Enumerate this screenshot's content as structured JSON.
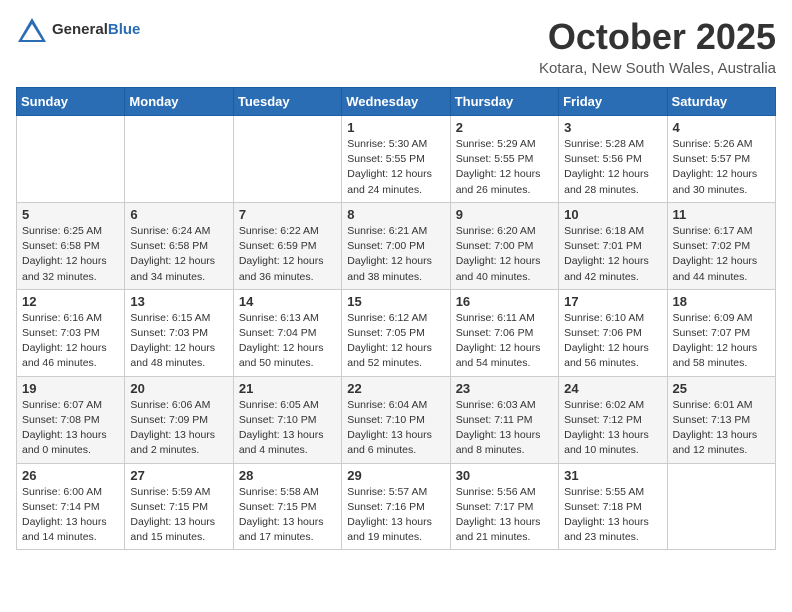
{
  "header": {
    "logo_general": "General",
    "logo_blue": "Blue",
    "month_title": "October 2025",
    "location": "Kotara, New South Wales, Australia"
  },
  "weekdays": [
    "Sunday",
    "Monday",
    "Tuesday",
    "Wednesday",
    "Thursday",
    "Friday",
    "Saturday"
  ],
  "weeks": [
    [
      {
        "day": "",
        "content": ""
      },
      {
        "day": "",
        "content": ""
      },
      {
        "day": "",
        "content": ""
      },
      {
        "day": "1",
        "content": "Sunrise: 5:30 AM\nSunset: 5:55 PM\nDaylight: 12 hours\nand 24 minutes."
      },
      {
        "day": "2",
        "content": "Sunrise: 5:29 AM\nSunset: 5:55 PM\nDaylight: 12 hours\nand 26 minutes."
      },
      {
        "day": "3",
        "content": "Sunrise: 5:28 AM\nSunset: 5:56 PM\nDaylight: 12 hours\nand 28 minutes."
      },
      {
        "day": "4",
        "content": "Sunrise: 5:26 AM\nSunset: 5:57 PM\nDaylight: 12 hours\nand 30 minutes."
      }
    ],
    [
      {
        "day": "5",
        "content": "Sunrise: 6:25 AM\nSunset: 6:58 PM\nDaylight: 12 hours\nand 32 minutes."
      },
      {
        "day": "6",
        "content": "Sunrise: 6:24 AM\nSunset: 6:58 PM\nDaylight: 12 hours\nand 34 minutes."
      },
      {
        "day": "7",
        "content": "Sunrise: 6:22 AM\nSunset: 6:59 PM\nDaylight: 12 hours\nand 36 minutes."
      },
      {
        "day": "8",
        "content": "Sunrise: 6:21 AM\nSunset: 7:00 PM\nDaylight: 12 hours\nand 38 minutes."
      },
      {
        "day": "9",
        "content": "Sunrise: 6:20 AM\nSunset: 7:00 PM\nDaylight: 12 hours\nand 40 minutes."
      },
      {
        "day": "10",
        "content": "Sunrise: 6:18 AM\nSunset: 7:01 PM\nDaylight: 12 hours\nand 42 minutes."
      },
      {
        "day": "11",
        "content": "Sunrise: 6:17 AM\nSunset: 7:02 PM\nDaylight: 12 hours\nand 44 minutes."
      }
    ],
    [
      {
        "day": "12",
        "content": "Sunrise: 6:16 AM\nSunset: 7:03 PM\nDaylight: 12 hours\nand 46 minutes."
      },
      {
        "day": "13",
        "content": "Sunrise: 6:15 AM\nSunset: 7:03 PM\nDaylight: 12 hours\nand 48 minutes."
      },
      {
        "day": "14",
        "content": "Sunrise: 6:13 AM\nSunset: 7:04 PM\nDaylight: 12 hours\nand 50 minutes."
      },
      {
        "day": "15",
        "content": "Sunrise: 6:12 AM\nSunset: 7:05 PM\nDaylight: 12 hours\nand 52 minutes."
      },
      {
        "day": "16",
        "content": "Sunrise: 6:11 AM\nSunset: 7:06 PM\nDaylight: 12 hours\nand 54 minutes."
      },
      {
        "day": "17",
        "content": "Sunrise: 6:10 AM\nSunset: 7:06 PM\nDaylight: 12 hours\nand 56 minutes."
      },
      {
        "day": "18",
        "content": "Sunrise: 6:09 AM\nSunset: 7:07 PM\nDaylight: 12 hours\nand 58 minutes."
      }
    ],
    [
      {
        "day": "19",
        "content": "Sunrise: 6:07 AM\nSunset: 7:08 PM\nDaylight: 13 hours\nand 0 minutes."
      },
      {
        "day": "20",
        "content": "Sunrise: 6:06 AM\nSunset: 7:09 PM\nDaylight: 13 hours\nand 2 minutes."
      },
      {
        "day": "21",
        "content": "Sunrise: 6:05 AM\nSunset: 7:10 PM\nDaylight: 13 hours\nand 4 minutes."
      },
      {
        "day": "22",
        "content": "Sunrise: 6:04 AM\nSunset: 7:10 PM\nDaylight: 13 hours\nand 6 minutes."
      },
      {
        "day": "23",
        "content": "Sunrise: 6:03 AM\nSunset: 7:11 PM\nDaylight: 13 hours\nand 8 minutes."
      },
      {
        "day": "24",
        "content": "Sunrise: 6:02 AM\nSunset: 7:12 PM\nDaylight: 13 hours\nand 10 minutes."
      },
      {
        "day": "25",
        "content": "Sunrise: 6:01 AM\nSunset: 7:13 PM\nDaylight: 13 hours\nand 12 minutes."
      }
    ],
    [
      {
        "day": "26",
        "content": "Sunrise: 6:00 AM\nSunset: 7:14 PM\nDaylight: 13 hours\nand 14 minutes."
      },
      {
        "day": "27",
        "content": "Sunrise: 5:59 AM\nSunset: 7:15 PM\nDaylight: 13 hours\nand 15 minutes."
      },
      {
        "day": "28",
        "content": "Sunrise: 5:58 AM\nSunset: 7:15 PM\nDaylight: 13 hours\nand 17 minutes."
      },
      {
        "day": "29",
        "content": "Sunrise: 5:57 AM\nSunset: 7:16 PM\nDaylight: 13 hours\nand 19 minutes."
      },
      {
        "day": "30",
        "content": "Sunrise: 5:56 AM\nSunset: 7:17 PM\nDaylight: 13 hours\nand 21 minutes."
      },
      {
        "day": "31",
        "content": "Sunrise: 5:55 AM\nSunset: 7:18 PM\nDaylight: 13 hours\nand 23 minutes."
      },
      {
        "day": "",
        "content": ""
      }
    ]
  ]
}
